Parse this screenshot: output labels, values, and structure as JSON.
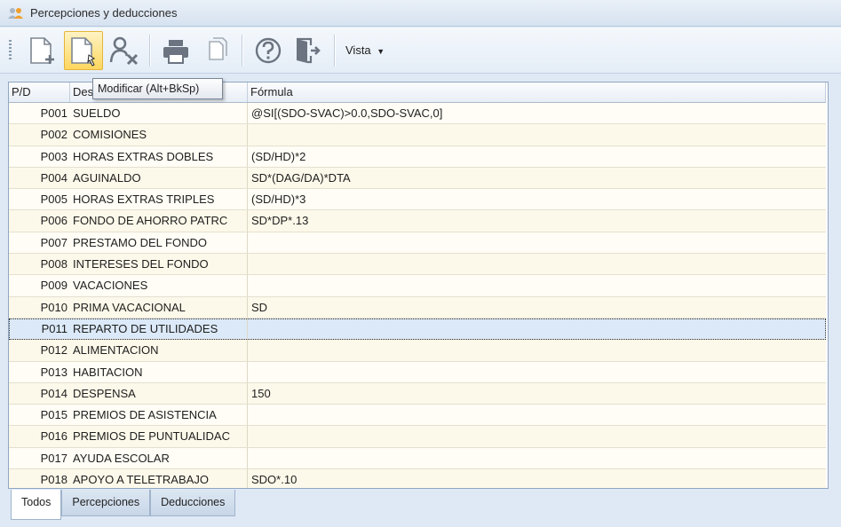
{
  "window": {
    "title": "Percepciones y deducciones"
  },
  "toolbar": {
    "buttons": [
      {
        "id": "nuevo",
        "icon": "new-document-icon"
      },
      {
        "id": "modificar",
        "icon": "edit-document-icon",
        "active": true
      },
      {
        "id": "eliminar",
        "icon": "delete-user-icon"
      },
      {
        "id": "imprimir",
        "icon": "printer-icon"
      },
      {
        "id": "copiar",
        "icon": "copy-icon"
      },
      {
        "id": "ayuda",
        "icon": "help-icon"
      },
      {
        "id": "salir",
        "icon": "exit-door-icon"
      }
    ],
    "vista_label": "Vista",
    "tooltip": "Modificar (Alt+BkSp)"
  },
  "grid": {
    "columns": [
      "P/D",
      "Descripción",
      "Fórmula"
    ],
    "header_visible": {
      "c1": "P/D",
      "c2": "Des",
      "c3": "Fórmula"
    },
    "rows": [
      {
        "code": "P001",
        "desc": "SUELDO",
        "formula": "@SI[(SDO-SVAC)>0.0,SDO-SVAC,0]"
      },
      {
        "code": "P002",
        "desc": "COMISIONES",
        "formula": ""
      },
      {
        "code": "P003",
        "desc": "HORAS EXTRAS DOBLES",
        "formula": "(SD/HD)*2"
      },
      {
        "code": "P004",
        "desc": "AGUINALDO",
        "formula": "SD*(DAG/DA)*DTA"
      },
      {
        "code": "P005",
        "desc": "HORAS EXTRAS TRIPLES",
        "formula": "(SD/HD)*3"
      },
      {
        "code": "P006",
        "desc": "FONDO DE AHORRO PATRC",
        "formula": "SD*DP*.13"
      },
      {
        "code": "P007",
        "desc": "PRESTAMO DEL FONDO",
        "formula": ""
      },
      {
        "code": "P008",
        "desc": "INTERESES DEL FONDO",
        "formula": ""
      },
      {
        "code": "P009",
        "desc": "VACACIONES",
        "formula": ""
      },
      {
        "code": "P010",
        "desc": "PRIMA VACACIONAL",
        "formula": "SD"
      },
      {
        "code": "P011",
        "desc": "REPARTO DE UTILIDADES",
        "formula": "",
        "selected": true
      },
      {
        "code": "P012",
        "desc": "ALIMENTACION",
        "formula": ""
      },
      {
        "code": "P013",
        "desc": "HABITACION",
        "formula": ""
      },
      {
        "code": "P014",
        "desc": "DESPENSA",
        "formula": "150"
      },
      {
        "code": "P015",
        "desc": "PREMIOS DE ASISTENCIA",
        "formula": ""
      },
      {
        "code": "P016",
        "desc": "PREMIOS DE PUNTUALIDAC",
        "formula": ""
      },
      {
        "code": "P017",
        "desc": "AYUDA ESCOLAR",
        "formula": ""
      },
      {
        "code": "P018",
        "desc": "APOYO A TELETRABAJO",
        "formula": "SDO*.10"
      }
    ]
  },
  "tabs": [
    {
      "label": "Todos",
      "active": true
    },
    {
      "label": "Percepciones",
      "active": false
    },
    {
      "label": "Deducciones",
      "active": false
    }
  ],
  "colors": {
    "accent": "#ffd75e",
    "selected_row": "#dbe9f8",
    "row_bg": "#fffdf5",
    "icon_gray": "#6b7480"
  }
}
